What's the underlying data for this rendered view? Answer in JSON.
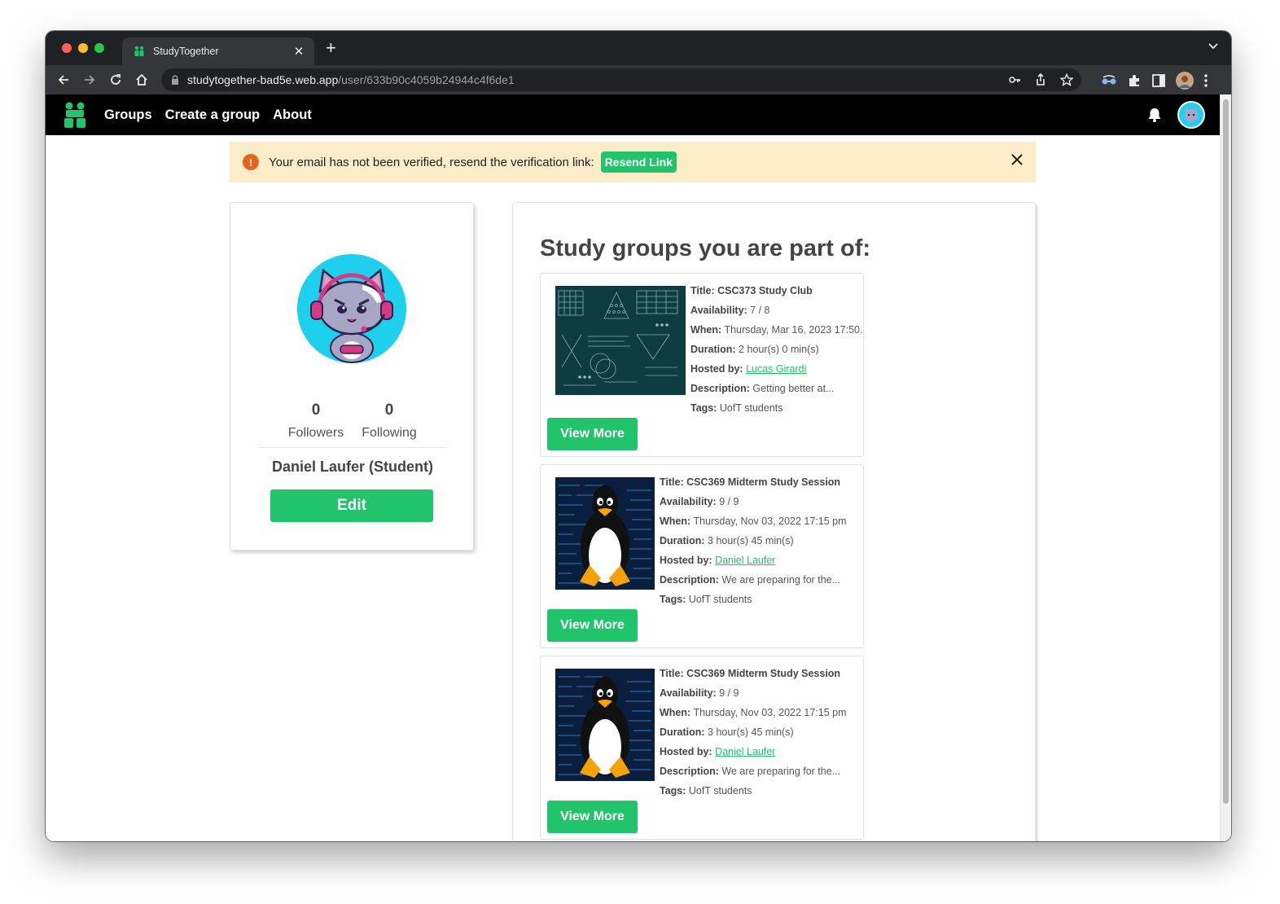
{
  "browser": {
    "tab_title": "StudyTogether",
    "tab_close": "✕",
    "new_tab": "+",
    "url_host": "studytogether-bad5e.web.app",
    "url_path": "/user/633b90c4059b24944c4f6de1"
  },
  "nav": {
    "links": [
      "Groups",
      "Create a group",
      "About"
    ]
  },
  "alert": {
    "icon": "!",
    "message": "Your email has not been verified, resend the verification link:",
    "button": "Resend Link"
  },
  "profile": {
    "followers_count": "0",
    "followers_label": "Followers",
    "following_count": "0",
    "following_label": "Following",
    "name": "Daniel Laufer (Student)",
    "edit_label": "Edit"
  },
  "groups_heading": "Study groups you are part of:",
  "field_labels": {
    "title": "Title:",
    "availability": "Availability:",
    "when": "When:",
    "duration": "Duration:",
    "hosted_by": "Hosted by:",
    "description": "Description:",
    "tags": "Tags:"
  },
  "groups": [
    {
      "title": "CSC373 Study Club",
      "availability": "7 / 8",
      "when": "Thursday, Mar 16, 2023 17:50.",
      "duration": "2 hour(s) 0 min(s)",
      "host": "Lucas Girardi",
      "description": "Getting better at...",
      "tags": "UofT students",
      "view_more": "View More",
      "image": "chalkboard-math-image"
    },
    {
      "title": "CSC369 Midterm Study Session",
      "availability": "9 / 9",
      "when": "Thursday, Nov 03, 2022 17:15 pm",
      "duration": "3 hour(s) 45 min(s)",
      "host": "Daniel Laufer",
      "description": "We are preparing for the...",
      "tags": "UofT students",
      "view_more": "View More",
      "image": "linux-penguin-image"
    },
    {
      "title": "CSC369 Midterm Study Session",
      "availability": "9 / 9",
      "when": "Thursday, Nov 03, 2022 17:15 pm",
      "duration": "3 hour(s) 45 min(s)",
      "host": "Daniel Laufer",
      "description": "We are preparing for the...",
      "tags": "UofT students",
      "view_more": "View More",
      "image": "linux-penguin-image"
    }
  ],
  "colors": {
    "brand_green": "#21c46b",
    "alert_bg": "#fdecc8",
    "alert_icon": "#e8641a",
    "avatar_bg": "#1fd0ec"
  }
}
